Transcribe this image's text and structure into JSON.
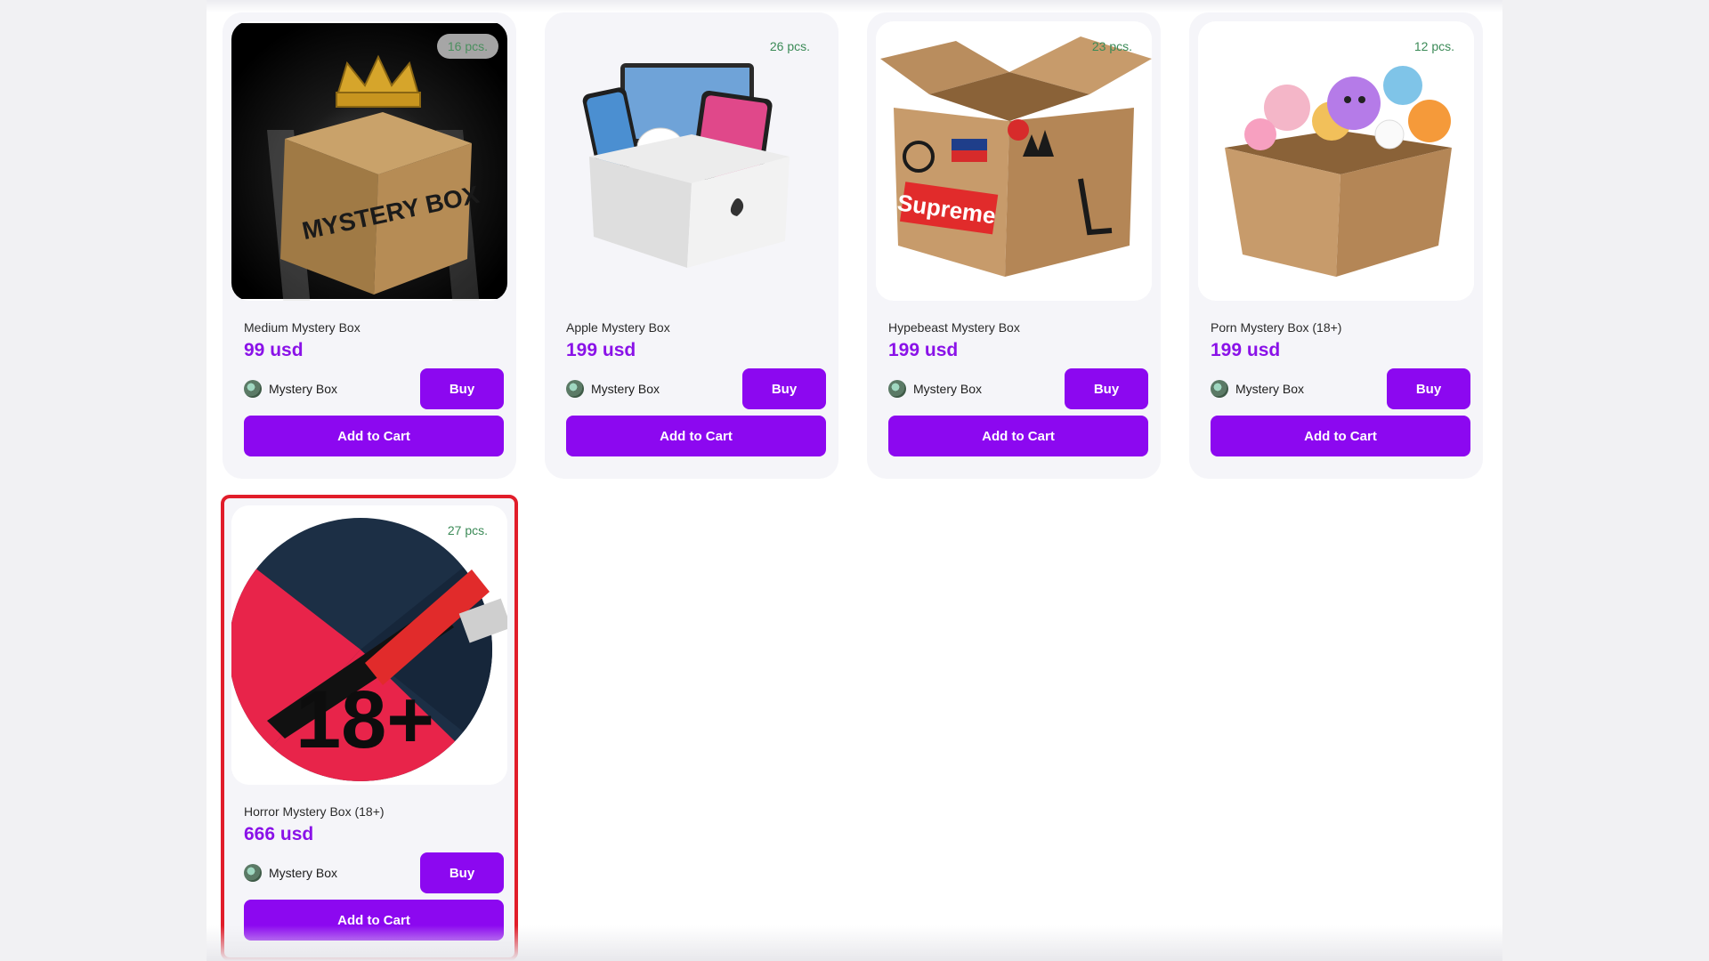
{
  "colors": {
    "accent": "#8c08f0",
    "price": "#8a12e8",
    "stock": "#3b8a57",
    "highlight_border": "#e11d2a"
  },
  "buy_label": "Buy",
  "cart_label": "Add to Cart",
  "seller_name": "Mystery Box",
  "products": [
    {
      "name": "Medium Mystery Box",
      "price": "99 usd",
      "stock": "16 pcs.",
      "image_icon": "mystery-box-crown-icon",
      "image_text": "MYSTERY BOX"
    },
    {
      "name": "Apple Mystery Box",
      "price": "199 usd",
      "stock": "26 pcs.",
      "image_icon": "apple-devices-box-icon"
    },
    {
      "name": "Hypebeast Mystery Box",
      "price": "199 usd",
      "stock": "23 pcs.",
      "image_icon": "brand-logos-box-icon",
      "image_text": "Supreme"
    },
    {
      "name": "Porn Mystery Box (18+)",
      "price": "199 usd",
      "stock": "12 pcs.",
      "image_icon": "squishy-toys-box-icon"
    },
    {
      "name": "Horror Mystery Box (18+)",
      "price": "666 usd",
      "stock": "27 pcs.",
      "image_icon": "knife-18plus-icon",
      "image_text": "18+"
    }
  ]
}
